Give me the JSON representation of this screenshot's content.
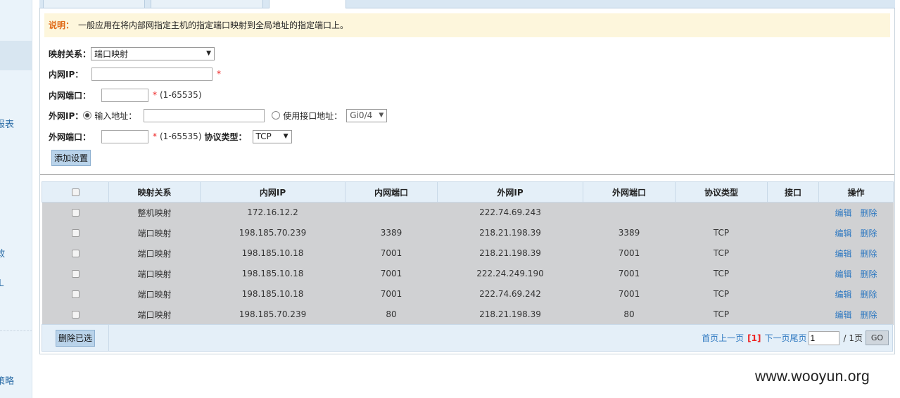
{
  "sidebar": {
    "fragments": [
      "报表",
      "敢",
      "L",
      "策略"
    ]
  },
  "note": {
    "label": "说明：",
    "text": "一般应用在将内部网指定主机的指定端口映射到全局地址的指定端口上。"
  },
  "form": {
    "mapping": {
      "label": "映射关系：",
      "value": "端口映射"
    },
    "lan_ip": {
      "label": "内网IP：",
      "value": "",
      "required_mark": "*"
    },
    "lan_port": {
      "label": "内网端口：",
      "value": "",
      "required_mark": "*",
      "hint": "(1-65535)"
    },
    "wan_ip": {
      "label": "外网IP：",
      "option_input": "输入地址：",
      "input_value": "",
      "option_interface": "使用接口地址：",
      "interface_value": "Gi0/4",
      "selected": "input"
    },
    "wan_port": {
      "label": "外网端口：",
      "value": "",
      "required_mark": "*",
      "hint": "(1-65535)"
    },
    "protocol": {
      "label": "协议类型：",
      "value": "TCP"
    },
    "add_button": "添加设置"
  },
  "table": {
    "headers": [
      "映射关系",
      "内网IP",
      "内网端口",
      "外网IP",
      "外网端口",
      "协议类型",
      "接口",
      "操作"
    ],
    "rows": [
      {
        "type": "整机映射",
        "lan_ip": "172.16.12.2",
        "lan_port": "",
        "wan_ip": "222.74.69.243",
        "wan_port": "",
        "protocol": "",
        "iface": "",
        "edit": "编辑",
        "del": "删除"
      },
      {
        "type": "端口映射",
        "lan_ip": "198.185.70.239",
        "lan_port": "3389",
        "wan_ip": "218.21.198.39",
        "wan_port": "3389",
        "protocol": "TCP",
        "iface": "",
        "edit": "编辑",
        "del": "删除"
      },
      {
        "type": "端口映射",
        "lan_ip": "198.185.10.18",
        "lan_port": "7001",
        "wan_ip": "218.21.198.39",
        "wan_port": "7001",
        "protocol": "TCP",
        "iface": "",
        "edit": "编辑",
        "del": "删除"
      },
      {
        "type": "端口映射",
        "lan_ip": "198.185.10.18",
        "lan_port": "7001",
        "wan_ip": "222.24.249.190",
        "wan_port": "7001",
        "protocol": "TCP",
        "iface": "",
        "edit": "编辑",
        "del": "删除"
      },
      {
        "type": "端口映射",
        "lan_ip": "198.185.10.18",
        "lan_port": "7001",
        "wan_ip": "222.74.69.242",
        "wan_port": "7001",
        "protocol": "TCP",
        "iface": "",
        "edit": "编辑",
        "del": "删除"
      },
      {
        "type": "端口映射",
        "lan_ip": "198.185.70.239",
        "lan_port": "80",
        "wan_ip": "218.21.198.39",
        "wan_port": "80",
        "protocol": "TCP",
        "iface": "",
        "edit": "编辑",
        "del": "删除"
      }
    ]
  },
  "footer": {
    "delete_selected": "删除已选",
    "first": "首页",
    "prev": "上一页",
    "current": "[1]",
    "next": "下一页",
    "last": "尾页",
    "page_input": "1",
    "total": "/ 1页",
    "go": "GO"
  },
  "watermark": "www.wooyun.org"
}
